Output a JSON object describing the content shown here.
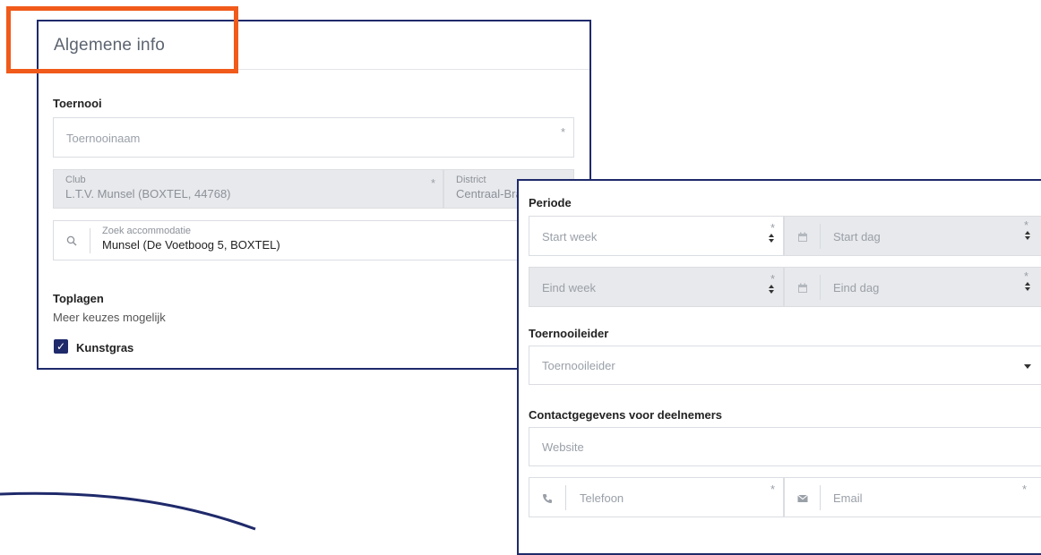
{
  "colors": {
    "highlight": "#f05a1a",
    "panel_border": "#1f2a6b",
    "checkbox": "#1f2a6b",
    "disabled_bg": "#e8e9ec"
  },
  "general": {
    "title": "Algemene info",
    "tournament_section": "Toernooi",
    "tournament_name_placeholder": "Toernooinaam",
    "required_mark": "*",
    "club_label": "Club",
    "club_value": "L.T.V. Munsel (BOXTEL, 44768)",
    "district_label": "District",
    "district_value": "Centraal-Bra",
    "accommodation_label": "Zoek accommodatie",
    "accommodation_value": "Munsel (De Voetboog 5, BOXTEL)",
    "surfaces_section": "Toplagen",
    "surfaces_hint": "Meer keuzes mogelijk",
    "surface_option": "Kunstgras",
    "surface_checked": true,
    "check_glyph": "✓"
  },
  "details": {
    "period_section": "Periode",
    "start_week_placeholder": "Start week",
    "start_day_placeholder": "Start dag",
    "end_week_placeholder": "Eind week",
    "end_day_placeholder": "Eind dag",
    "leader_section": "Toernooileider",
    "leader_placeholder": "Toernooileider",
    "contact_section": "Contactgegevens voor deelnemers",
    "website_placeholder": "Website",
    "phone_placeholder": "Telefoon",
    "email_placeholder": "Email"
  },
  "icons": {
    "search": "search-icon",
    "calendar": "calendar-icon",
    "phone": "phone-icon",
    "email": "envelope-icon",
    "sort": "sort-caret-icon",
    "dropdown": "chevron-down-icon"
  }
}
